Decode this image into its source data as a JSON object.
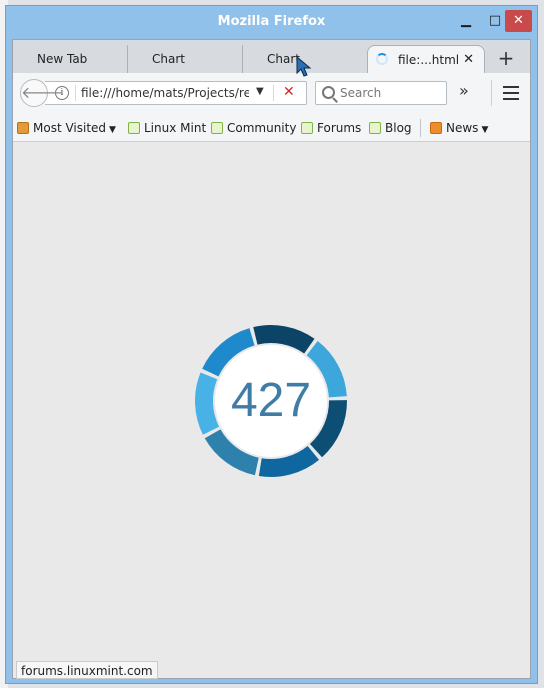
{
  "window": {
    "title": "Mozilla Firefox"
  },
  "tabs": [
    {
      "label": "New Tab"
    },
    {
      "label": "Chart"
    },
    {
      "label": "Chart"
    },
    {
      "label": "file:...html",
      "active": true
    }
  ],
  "navbar": {
    "url": "file:///home/mats/Projects/rev",
    "search_placeholder": "Search"
  },
  "bookmarks": [
    {
      "label": "Most Visited",
      "icon": "folder-icon",
      "dropdown": true
    },
    {
      "label": "Linux Mint",
      "icon": "mint-icon"
    },
    {
      "label": "Community",
      "icon": "mint-icon"
    },
    {
      "label": "Forums",
      "icon": "mint-icon"
    },
    {
      "label": "Blog",
      "icon": "mint-icon"
    },
    {
      "label": "News",
      "icon": "rss-icon",
      "dropdown": true
    }
  ],
  "gauge": {
    "value": "427",
    "segment_colors": [
      "#0b4466",
      "#3da6da",
      "#0d4e74",
      "#10679f",
      "#2f81ad",
      "#48b2e6",
      "#1e8acb"
    ]
  },
  "statusbar": {
    "text": "forums.linuxmint.com"
  }
}
